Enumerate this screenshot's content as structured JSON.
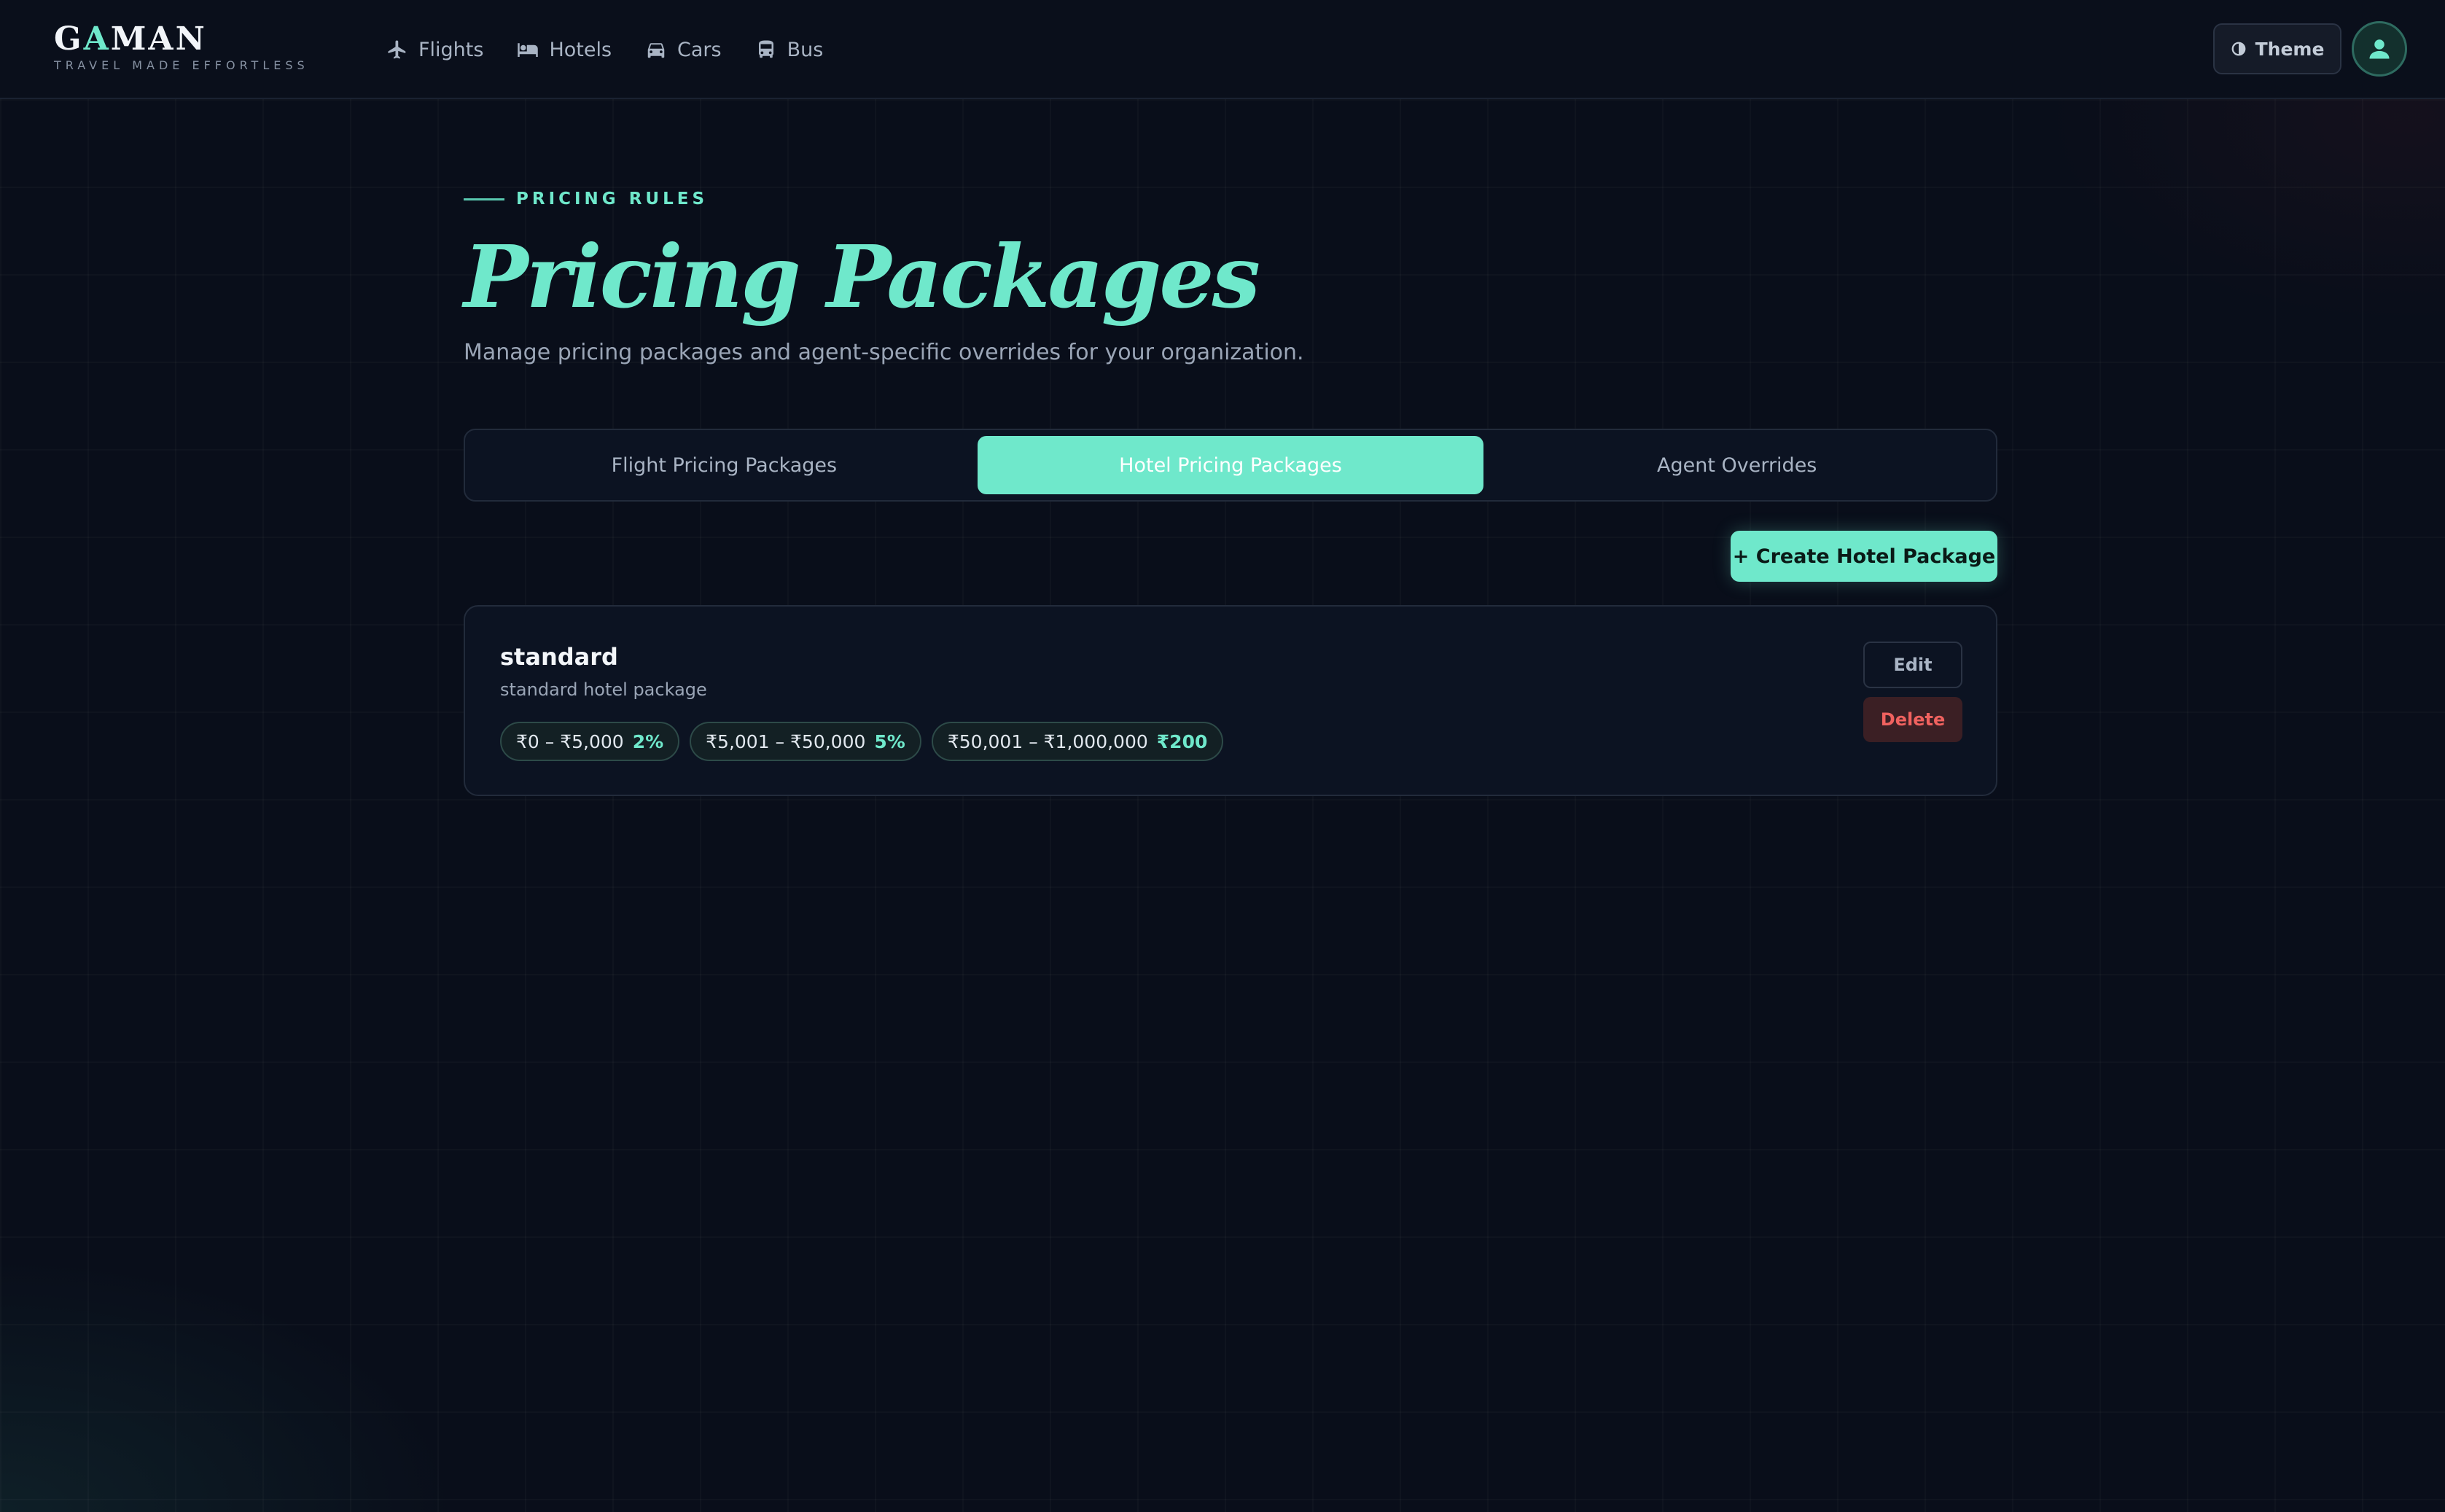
{
  "brand": {
    "name_pre": "G",
    "name_accent": "A",
    "name_post": "MAN",
    "tagline": "TRAVEL MADE EFFORTLESS"
  },
  "nav": {
    "items": [
      {
        "label": "Flights",
        "icon": "airplane-icon"
      },
      {
        "label": "Hotels",
        "icon": "bed-icon"
      },
      {
        "label": "Cars",
        "icon": "car-icon"
      },
      {
        "label": "Bus",
        "icon": "bus-icon"
      }
    ]
  },
  "header": {
    "theme_label": "Theme",
    "theme_icon": "contrast-icon",
    "avatar_icon": "user-icon"
  },
  "page": {
    "eyebrow": "PRICING RULES",
    "title": "Pricing Packages",
    "subtitle": "Manage pricing packages and agent-specific overrides for your organization."
  },
  "tabs": [
    {
      "label": "Flight Pricing Packages",
      "active": false
    },
    {
      "label": "Hotel Pricing Packages",
      "active": true
    },
    {
      "label": "Agent Overrides",
      "active": false
    }
  ],
  "actions": {
    "create_label": "+ Create Hotel Package"
  },
  "packages": [
    {
      "name": "standard",
      "description": "standard hotel package",
      "tiers": [
        {
          "range": "₹0 – ₹5,000",
          "value": "2%"
        },
        {
          "range": "₹5,001 – ₹50,000",
          "value": "5%"
        },
        {
          "range": "₹50,001 – ₹1,000,000",
          "value": "₹200"
        }
      ],
      "edit_label": "Edit",
      "delete_label": "Delete"
    }
  ],
  "colors": {
    "background": "#090e1a",
    "accent": "#6fe8cb",
    "danger": "#f0625f",
    "muted_text": "#9aa5b6"
  }
}
